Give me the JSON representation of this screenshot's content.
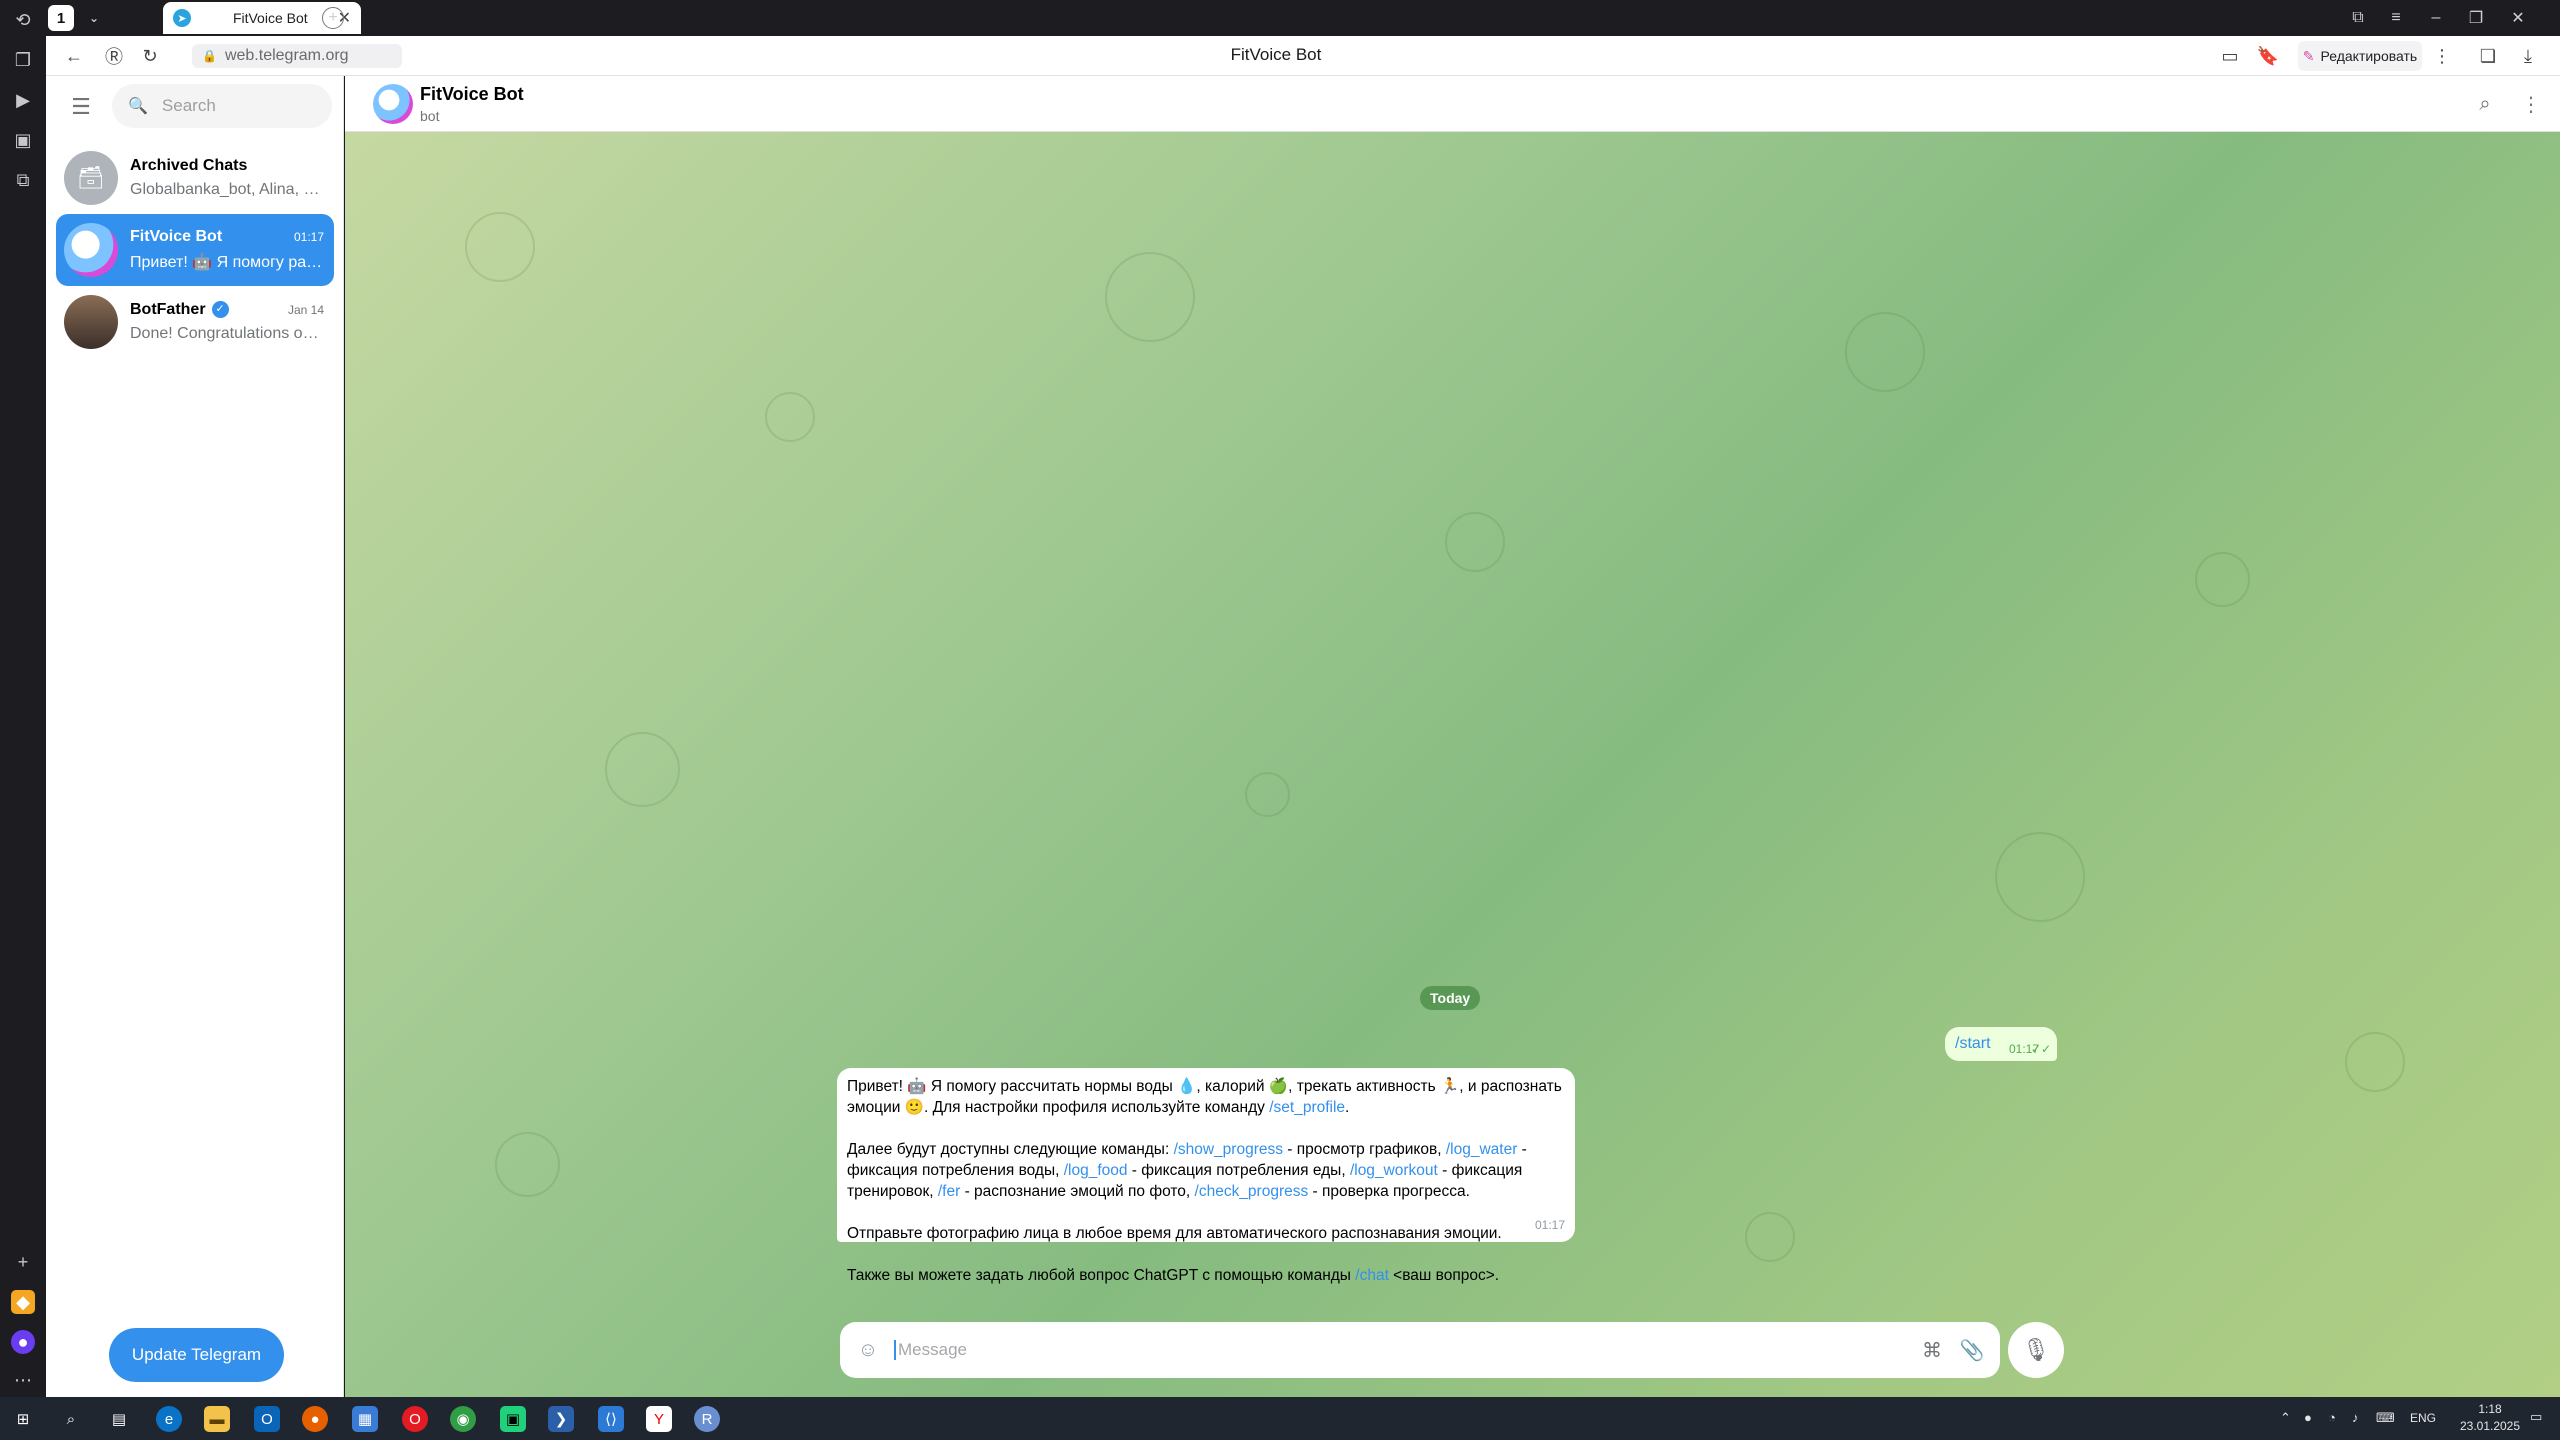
{
  "browser": {
    "tab_count": "1",
    "tab_title": "FitVoice Bot",
    "url": "web.telegram.org",
    "page_title": "FitVoice Bot",
    "edit_label": "Редактировать"
  },
  "sidebar": {
    "search_placeholder": "Search",
    "chats": [
      {
        "name": "Archived Chats",
        "preview": "Globalbanka_bot, Alina, V...",
        "time": ""
      },
      {
        "name": "FitVoice Bot",
        "preview": "Привет! 🤖 Я помогу рас...",
        "time": "01:17"
      },
      {
        "name": "BotFather",
        "preview": "Done! Congratulations on...",
        "time": "Jan 14"
      }
    ],
    "update_button": "Update Telegram"
  },
  "chat": {
    "title": "FitVoice Bot",
    "subtitle": "bot",
    "date_badge": "Today",
    "outgoing": {
      "text": "/start",
      "time": "01:17"
    },
    "incoming": {
      "p1a": "Привет! 🤖 Я помогу рассчитать нормы воды 💧, калорий 🍏, трекать активность 🏃, и распознать эмоции 🙂. Для настройки профиля используйте команду ",
      "p1cmd": "/set_profile",
      "p1b": ".",
      "p2a": "Далее будут доступны следующие команды: ",
      "cmd_show_progress": "/show_progress",
      "p2b": " - просмотр графиков, ",
      "cmd_log_water": "/log_water",
      "p2c": " - фиксация потребления воды, ",
      "cmd_log_food": "/log_food",
      "p2d": " - фиксация потребления еды, ",
      "cmd_log_workout": "/log_workout",
      "p2e": " - фиксация тренировок, ",
      "cmd_fer": "/fer",
      "p2f": " - распознание эмоций по фото, ",
      "cmd_check_progress": "/check_progress",
      "p2g": " - проверка прогресса.",
      "p3": "Отправьте фотографию лица в любое время для автоматического распознавания эмоции.",
      "p4a": "Также вы можете задать любой вопрос ChatGPT с помощью команды ",
      "cmd_chat": "/chat",
      "p4b": " <ваш вопрос>.",
      "time": "01:17"
    },
    "composer_placeholder": "Message"
  },
  "taskbar": {
    "lang": "ENG",
    "time": "1:18",
    "date": "23.01.2025"
  }
}
